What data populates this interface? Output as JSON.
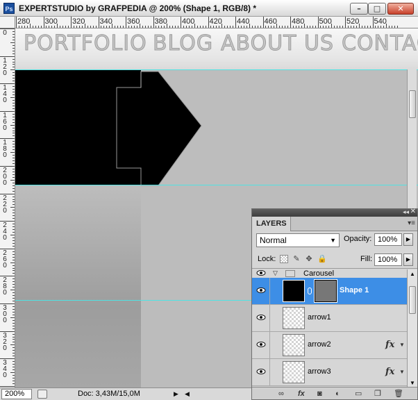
{
  "window": {
    "app_icon": "Ps",
    "title": "EXPERTSTUDIO by GRAFPEDIA @ 200% (Shape 1, RGB/8) *",
    "minimize": "–",
    "maximize": "□",
    "close": "✕"
  },
  "ruler_top": [
    "280",
    "300",
    "320",
    "340",
    "360",
    "380",
    "400",
    "420",
    "440",
    "460",
    "480",
    "500",
    "520",
    "540"
  ],
  "ruler_left": [
    {
      "digits": [
        "0"
      ]
    },
    {
      "digits": [
        "1",
        "2",
        "0"
      ]
    },
    {
      "digits": [
        "1",
        "4",
        "0"
      ]
    },
    {
      "digits": [
        "1",
        "6",
        "0"
      ]
    },
    {
      "digits": [
        "1",
        "8",
        "0"
      ]
    },
    {
      "digits": [
        "2",
        "0",
        "0"
      ]
    },
    {
      "digits": [
        "2",
        "2",
        "0"
      ]
    },
    {
      "digits": [
        "2",
        "4",
        "0"
      ]
    },
    {
      "digits": [
        "2",
        "6",
        "0"
      ]
    },
    {
      "digits": [
        "2",
        "8",
        "0"
      ]
    },
    {
      "digits": [
        "3",
        "0",
        "0"
      ]
    },
    {
      "digits": [
        "3",
        "2",
        "0"
      ]
    },
    {
      "digits": [
        "3",
        "4",
        "0"
      ]
    },
    {
      "digits": [
        "3",
        "6"
      ]
    }
  ],
  "canvas": {
    "nav": [
      "PORTFOLIO",
      "BLOG",
      "ABOUT US",
      "CONTAC"
    ]
  },
  "status": {
    "zoom": "200%",
    "doc": "Doc: 3,43M/15,0M"
  },
  "layers_panel": {
    "tab": "LAYERS",
    "blend_mode": "Normal",
    "opacity_label": "Opacity:",
    "opacity": "100%",
    "lock_label": "Lock:",
    "fill_label": "Fill:",
    "fill": "100%",
    "group": "Carousel",
    "layers": [
      {
        "name": "Shape 1",
        "selected": true,
        "fx": false
      },
      {
        "name": "arrow1",
        "selected": false,
        "fx": false
      },
      {
        "name": "arrow2",
        "selected": false,
        "fx": true
      },
      {
        "name": "arrow3",
        "selected": false,
        "fx": true
      }
    ],
    "fx_label": "fx"
  },
  "colors": {
    "selection": "#3d8ee6",
    "guide": "#4fe3e3"
  }
}
